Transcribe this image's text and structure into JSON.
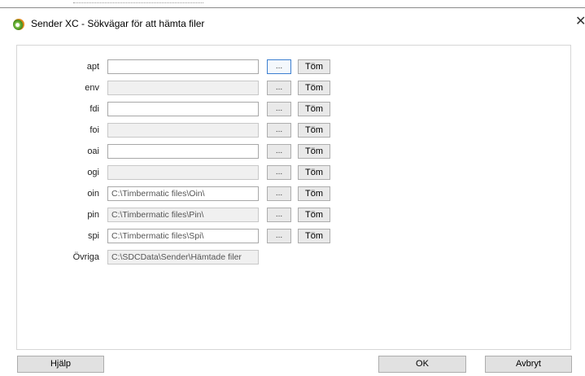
{
  "window": {
    "title": "Sender XC - Sökvägar för att hämta filer",
    "close_glyph": "✕",
    "icon": "app-logo-icon"
  },
  "rows": [
    {
      "label": "apt",
      "value": "",
      "disabled": false,
      "browse_label": "...",
      "clear_label": "Töm"
    },
    {
      "label": "env",
      "value": "",
      "disabled": true,
      "browse_label": "...",
      "clear_label": "Töm"
    },
    {
      "label": "fdi",
      "value": "",
      "disabled": false,
      "browse_label": "...",
      "clear_label": "Töm"
    },
    {
      "label": "foi",
      "value": "",
      "disabled": true,
      "browse_label": "...",
      "clear_label": "Töm"
    },
    {
      "label": "oai",
      "value": "",
      "disabled": false,
      "browse_label": "...",
      "clear_label": "Töm"
    },
    {
      "label": "ogi",
      "value": "",
      "disabled": true,
      "browse_label": "...",
      "clear_label": "Töm"
    },
    {
      "label": "oin",
      "value": "C:\\Timbermatic files\\Oin\\",
      "disabled": false,
      "browse_label": "...",
      "clear_label": "Töm"
    },
    {
      "label": "pin",
      "value": "C:\\Timbermatic files\\Pin\\",
      "disabled": true,
      "browse_label": "...",
      "clear_label": "Töm"
    },
    {
      "label": "spi",
      "value": "C:\\Timbermatic files\\Spi\\",
      "disabled": false,
      "browse_label": "...",
      "clear_label": "Töm"
    }
  ],
  "other": {
    "label": "Övriga",
    "value": "C:\\SDCData\\Sender\\Hämtade filer"
  },
  "buttons": {
    "help": "Hjälp",
    "ok": "OK",
    "cancel": "Avbryt"
  }
}
